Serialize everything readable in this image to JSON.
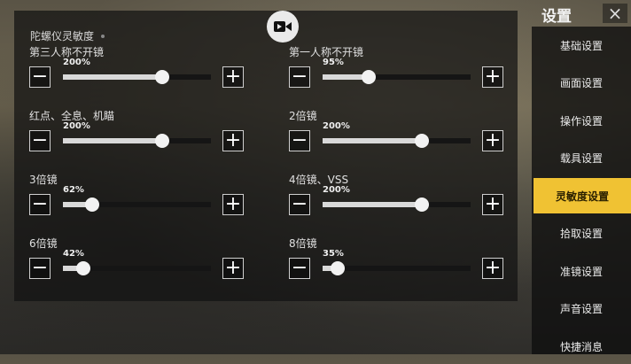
{
  "header": {
    "title": "设置",
    "close_label": "×"
  },
  "panel": {
    "section_title": "陀螺仪灵敏度",
    "icon": "video-camera-icon"
  },
  "sliders": [
    {
      "label": "第三人称不开镜",
      "value_text": "200%",
      "fraction": 0.67,
      "col": 0,
      "row": 0
    },
    {
      "label": "第一人称不开镜",
      "value_text": "95%",
      "fraction": 0.31,
      "col": 1,
      "row": 0
    },
    {
      "label": "红点、全息、机瞄",
      "value_text": "200%",
      "fraction": 0.67,
      "col": 0,
      "row": 1
    },
    {
      "label": "2倍镜",
      "value_text": "200%",
      "fraction": 0.67,
      "col": 1,
      "row": 1
    },
    {
      "label": "3倍镜",
      "value_text": "62%",
      "fraction": 0.2,
      "col": 0,
      "row": 2
    },
    {
      "label": "4倍镜、VSS",
      "value_text": "200%",
      "fraction": 0.67,
      "col": 1,
      "row": 2
    },
    {
      "label": "6倍镜",
      "value_text": "42%",
      "fraction": 0.14,
      "col": 0,
      "row": 3
    },
    {
      "label": "8倍镜",
      "value_text": "35%",
      "fraction": 0.1,
      "col": 1,
      "row": 3
    }
  ],
  "step": {
    "minus": "−",
    "plus": "+"
  },
  "sidebar": {
    "items": [
      {
        "label": "基础设置",
        "active": false
      },
      {
        "label": "画面设置",
        "active": false
      },
      {
        "label": "操作设置",
        "active": false
      },
      {
        "label": "载具设置",
        "active": false
      },
      {
        "label": "灵敏度设置",
        "active": true
      },
      {
        "label": "拾取设置",
        "active": false
      },
      {
        "label": "准镜设置",
        "active": false
      },
      {
        "label": "声音设置",
        "active": false
      },
      {
        "label": "快捷消息",
        "active": false
      }
    ]
  },
  "colors": {
    "accent": "#f0c233"
  }
}
